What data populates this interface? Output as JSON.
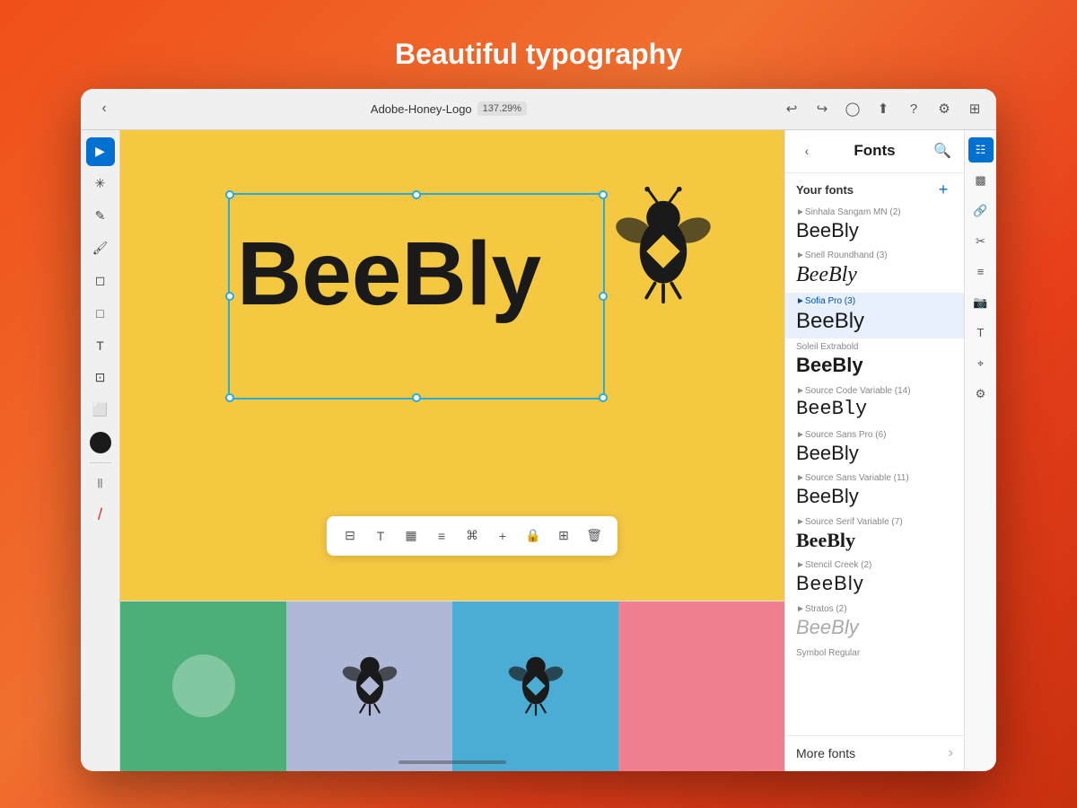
{
  "page": {
    "title": "Beautiful typography"
  },
  "titlebar": {
    "filename": "Adobe-Honey-Logo",
    "zoom": "137.29%",
    "back_label": "‹"
  },
  "toolbar": {
    "tools": [
      {
        "name": "select",
        "icon": "▲",
        "active": true
      },
      {
        "name": "puppet-warp",
        "icon": "✳"
      },
      {
        "name": "pencil",
        "icon": "✏"
      },
      {
        "name": "brush",
        "icon": "🖌"
      },
      {
        "name": "eraser",
        "icon": "◻"
      },
      {
        "name": "shape",
        "icon": "□"
      },
      {
        "name": "text",
        "icon": "T"
      },
      {
        "name": "transform",
        "icon": "⊡"
      },
      {
        "name": "image",
        "icon": "⬜"
      },
      {
        "name": "gradient",
        "icon": "◕"
      },
      {
        "name": "stroke",
        "icon": "||"
      },
      {
        "name": "red-brush",
        "icon": "/"
      }
    ]
  },
  "canvas": {
    "beebly_text": "BeeBly",
    "background_color": "#f5c842"
  },
  "context_toolbar": {
    "buttons": [
      "⊟",
      "T",
      "▦",
      "≡",
      "⌘",
      "+",
      "🔒",
      "⊞",
      "🗑"
    ]
  },
  "fonts_panel": {
    "title": "Fonts",
    "section_title": "Your fonts",
    "back_label": "‹",
    "fonts": [
      {
        "name": "Sinhala Sangam MN (2)",
        "preview": "BeeBly",
        "style": "normal"
      },
      {
        "name": "Snell Roundhand (3)",
        "preview": "BeeBly",
        "style": "script"
      },
      {
        "name": "Sofia Pro (3)",
        "preview": "BeeBly",
        "style": "sofia",
        "selected": true
      },
      {
        "name": "Soleil Extrabold",
        "preview": "BeeBly",
        "style": "bold"
      },
      {
        "name": "Source Code Variable (14)",
        "preview": "BeeBly",
        "style": "mono"
      },
      {
        "name": "Source Sans Pro (6)",
        "preview": "BeeBly",
        "style": "normal"
      },
      {
        "name": "Source Sans Variable (11)",
        "preview": "BeeBly",
        "style": "normal"
      },
      {
        "name": "Source Serif Variable (7)",
        "preview": "BeeBly",
        "style": "serif"
      },
      {
        "name": "Stencil Creek (2)",
        "preview": "BeeBly",
        "style": "stencil"
      },
      {
        "name": "Stratos (2)",
        "preview": "BeeBly",
        "style": "stratos"
      },
      {
        "name": "Symbol Regular",
        "preview": "",
        "style": "normal"
      }
    ],
    "more_fonts_label": "More fonts",
    "more_fonts_chevron": "›"
  },
  "micro_toolbar": {
    "icons": [
      "layers",
      "image-adjust",
      "link",
      "scissors",
      "bars",
      "camera",
      "text-style",
      "puppet",
      "settings"
    ]
  },
  "thumbnails": [
    {
      "bg": "#4caf7a"
    },
    {
      "bg": "#b0b8d8"
    },
    {
      "bg": "#4badd4"
    },
    {
      "bg": "#f08090"
    }
  ]
}
